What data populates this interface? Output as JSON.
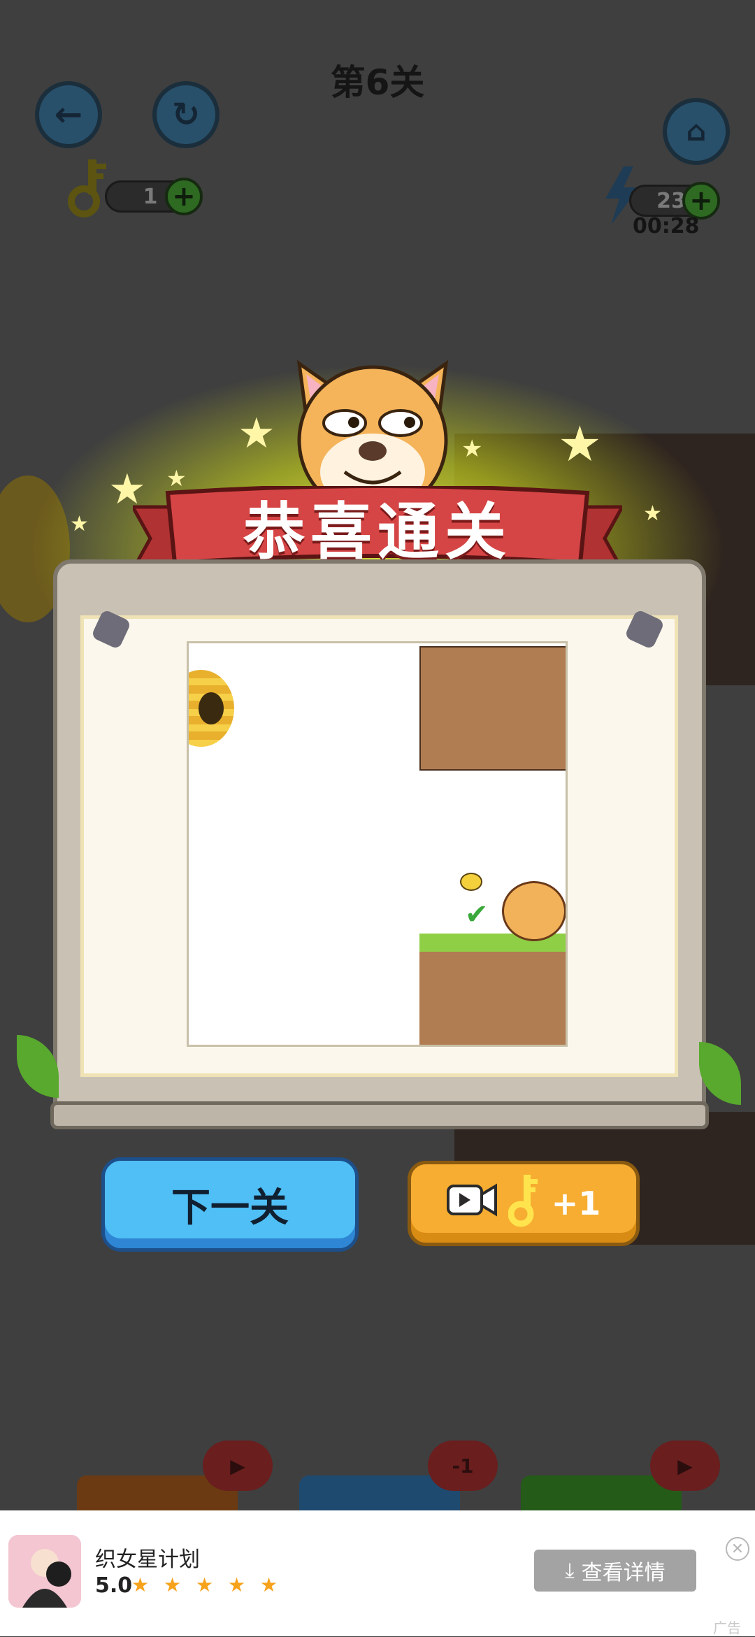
{
  "header": {
    "level_title": "第6关",
    "keys_count": "1",
    "energy_count": "23",
    "timer": "00:28"
  },
  "icons": {
    "back": "arrow-left",
    "restart": "refresh",
    "home": "home",
    "key": "key",
    "energy": "lightning",
    "plus": "plus",
    "video": "video-camera",
    "close": "close",
    "download": "download"
  },
  "popup": {
    "banner_title": "恭喜通关",
    "next_button": "下一关",
    "reward_label": "+1"
  },
  "background_buttons": {
    "hint_badge": "-1"
  },
  "ad": {
    "app_name": "织女星计划",
    "rating": "5.0",
    "stars": "★ ★ ★ ★ ★",
    "rating_value": 5,
    "cta": "查看详情",
    "ad_label": "广告"
  },
  "colors": {
    "banner_red": "#d64545",
    "next_blue": "#4fbff5",
    "reward_orange": "#f6ad31",
    "star_orange": "#f7a21b"
  }
}
